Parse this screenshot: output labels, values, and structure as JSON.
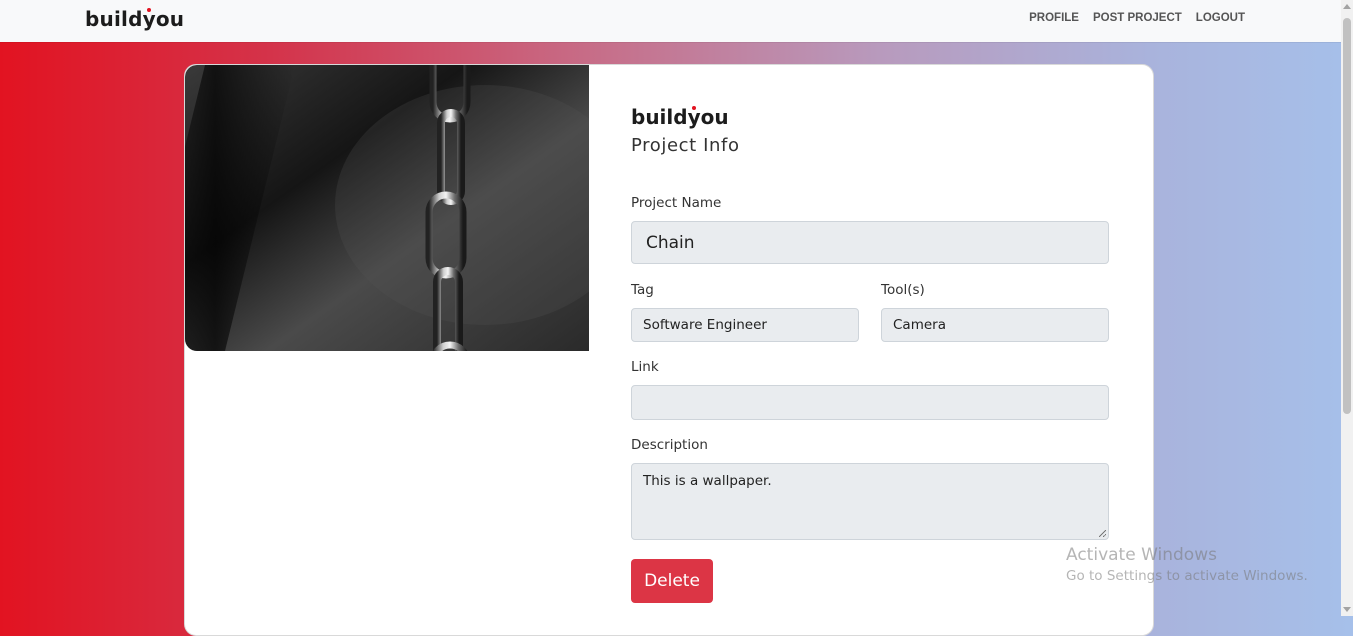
{
  "navbar": {
    "brand": {
      "prefix": "build",
      "dotted": "y",
      "suffix": "ou"
    },
    "links": [
      "PROFILE",
      "POST PROJECT",
      "LOGOUT"
    ]
  },
  "form": {
    "brand": {
      "prefix": "build",
      "dotted": "y",
      "suffix": "ou"
    },
    "title": "Project Info",
    "project_name": {
      "label": "Project Name",
      "value": "Chain"
    },
    "tag": {
      "label": "Tag",
      "value": "Software Engineer"
    },
    "tools": {
      "label": "Tool(s)",
      "value": "Camera"
    },
    "link": {
      "label": "Link",
      "value": ""
    },
    "description": {
      "label": "Description",
      "value": "This is a wallpaper."
    },
    "delete_label": "Delete"
  },
  "watermark": {
    "title": "Activate Windows",
    "subtitle": "Go to Settings to activate Windows."
  },
  "colors": {
    "brand_dot": "#e21321",
    "delete_button": "#dc3545",
    "input_bg": "#e9ecef"
  },
  "image": {
    "subject": "black-and-white metal chain photo",
    "icon": "chain-photo"
  }
}
